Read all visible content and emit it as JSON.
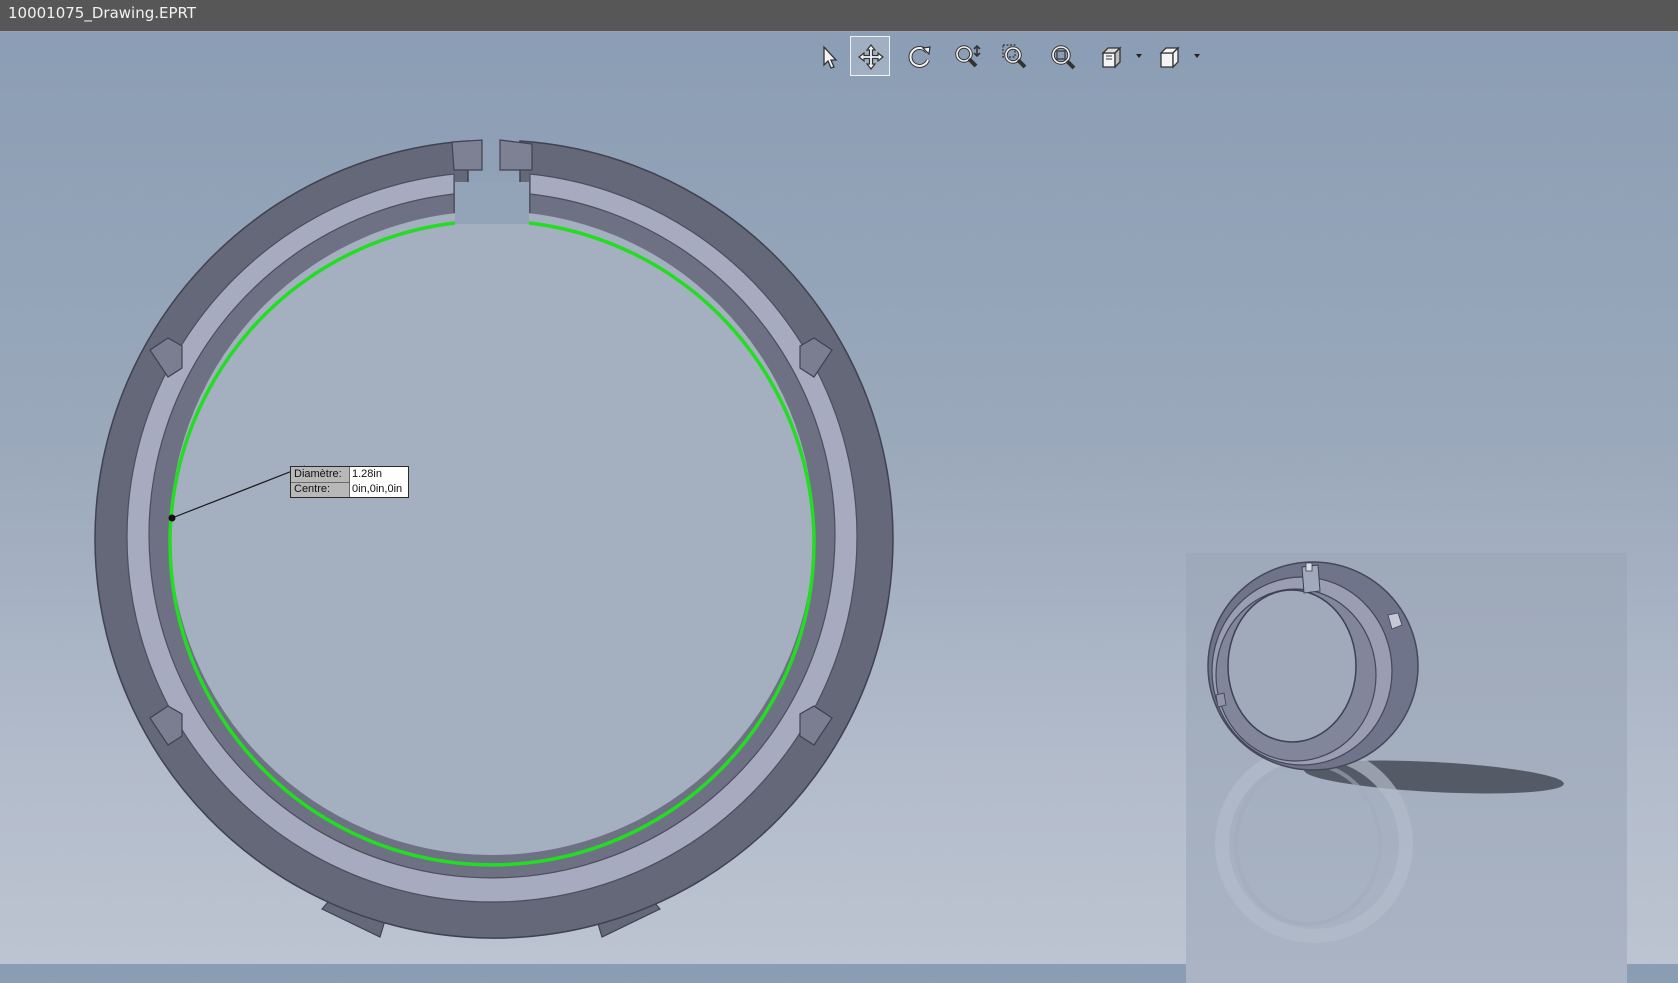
{
  "window": {
    "title": "10001075_Drawing.EPRT"
  },
  "toolbar": {
    "tools": [
      {
        "name": "select",
        "icon": "pointer-arrow-icon",
        "active": false
      },
      {
        "name": "pan",
        "icon": "move-arrows-icon",
        "active": true
      },
      {
        "name": "rotate",
        "icon": "rotate-icon",
        "active": false
      },
      {
        "name": "zoom-in-out",
        "icon": "zoom-in-out-icon",
        "active": false
      },
      {
        "name": "zoom-to-area",
        "icon": "zoom-area-icon",
        "active": false
      },
      {
        "name": "zoom-to-fit",
        "icon": "zoom-fit-icon",
        "active": false
      },
      {
        "name": "view-orientation",
        "icon": "view-orientation-icon",
        "active": false
      },
      {
        "name": "display-style",
        "icon": "display-style-cube-icon",
        "active": false
      }
    ]
  },
  "measure": {
    "diameter_label": "Diamètre:",
    "diameter_value": "1.28in",
    "center_label": "Centre:",
    "center_value": "0in,0in,0in"
  },
  "colors": {
    "titlebar": "#575757",
    "part_dark": "#5f6272",
    "part_face": "#7d8094",
    "part_light": "#a5a9bd",
    "highlight_edge": "#22dd22",
    "viewport_top": "#8a9db4",
    "viewport_bottom": "#bcc4d1"
  }
}
